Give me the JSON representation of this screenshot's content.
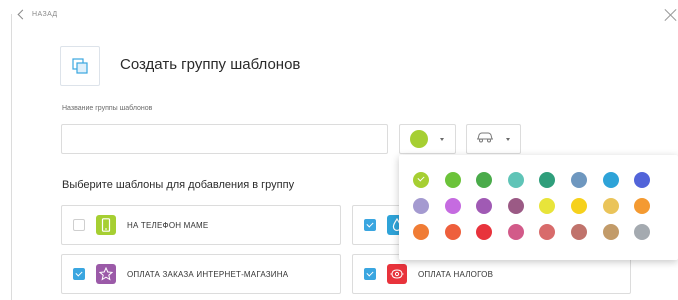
{
  "nav": {
    "back_label": "НАЗАД",
    "back_icon": "chevron-left-icon",
    "close_icon": "close-icon"
  },
  "header": {
    "title": "Создать группу шаблонов",
    "icon": "template-group-icon"
  },
  "form": {
    "name_label": "Название группы шаблонов",
    "name_value": "",
    "color_dropdown": {
      "selected_color": "#a6cf32",
      "caret_icon": "caret-down-icon"
    },
    "icon_dropdown": {
      "selected_icon": "car-icon",
      "caret_icon": "caret-down-icon"
    }
  },
  "templates": {
    "heading": "Выберите шаблоны для добавления в группу",
    "items": [
      {
        "name": "НА ТЕЛЕФОН МАМЕ",
        "checked": false,
        "icon": "phone-icon",
        "icon_color": "#a6cf32"
      },
      {
        "name": "",
        "checked": true,
        "icon": "water-drop-icon",
        "icon_color": "#2ea3d8"
      },
      {
        "name": "ОПЛАТА ЗАКАЗА ИНТЕРНЕТ-МАГАЗИНА",
        "checked": true,
        "icon": "star-icon",
        "icon_color": "#9b5aa8"
      },
      {
        "name": "ОПЛАТА НАЛОГОВ",
        "checked": true,
        "icon": "taxes-icon",
        "icon_color": "#e83e3e"
      }
    ]
  },
  "palette": {
    "selected_index": 0,
    "colors": [
      "#a6cf32",
      "#6cc33a",
      "#4aab4a",
      "#5fc4b7",
      "#2f9e7b",
      "#6e97bf",
      "#2ea3d8",
      "#5264d9",
      "#a49ad0",
      "#c56be0",
      "#a05ab4",
      "#9b5a85",
      "#e8e43a",
      "#f6d11c",
      "#eac45a",
      "#f49a31",
      "#f07c35",
      "#ee5f3c",
      "#e8333c",
      "#d25a89",
      "#d86b6b",
      "#c0736c",
      "#c29b69",
      "#a4aab0"
    ]
  }
}
